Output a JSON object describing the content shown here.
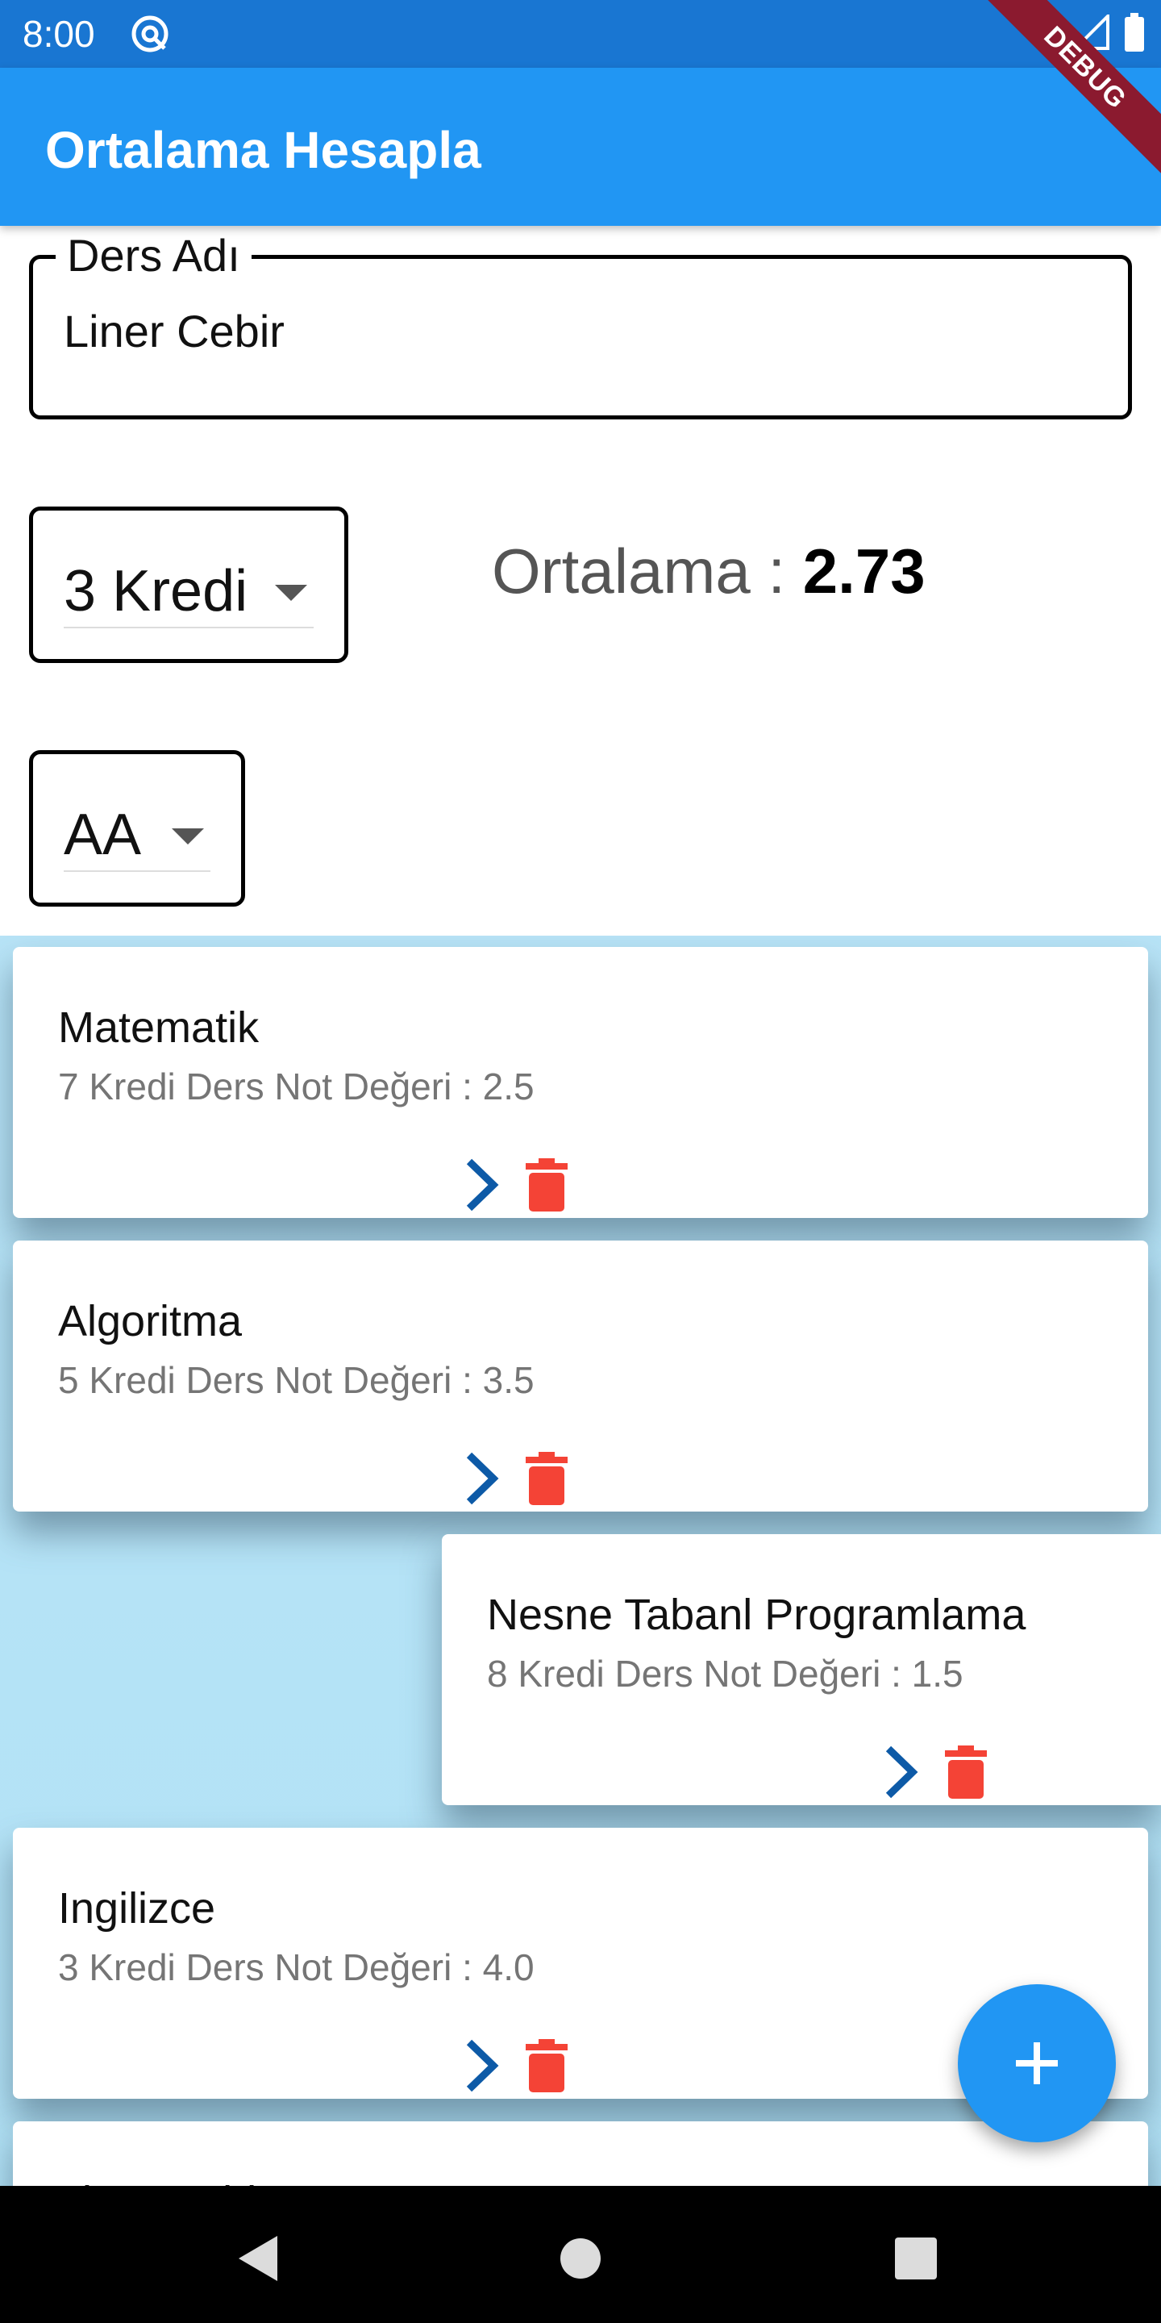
{
  "status_bar": {
    "time": "8:00"
  },
  "app_bar": {
    "title": "Ortalama Hesapla"
  },
  "debug_banner": "DEBUG",
  "form": {
    "course_label": "Ders Adı",
    "course_value": "Liner Cebir",
    "credit_selected": "3 Kredi",
    "grade_selected": "AA",
    "average_label": "Ortalama : ",
    "average_value": "2.73"
  },
  "courses": [
    {
      "name": "Matematik",
      "detail": "7 Kredi Ders Not Değeri : 2.5"
    },
    {
      "name": "Algoritma",
      "detail": "5 Kredi Ders Not Değeri : 3.5"
    },
    {
      "name": "Nesne Tabanl Programlama",
      "detail": "8 Kredi Ders Not Değeri : 1.5"
    },
    {
      "name": "Ingilizce",
      "detail": "3 Kredi Ders Not Değeri : 4.0"
    },
    {
      "name": "Liner Cebir",
      "detail": ""
    }
  ],
  "colors": {
    "status_bar": "#1976D2",
    "app_bar": "#2196F3",
    "list_background": "#b8e4f7",
    "chevron": "#0D5AA7",
    "delete": "#F44336",
    "fab": "#2196F3",
    "debug_banner": "#8B1A2F"
  },
  "icons": {
    "status_app": "at-icon",
    "wifi": "wifi-icon",
    "signal": "signal-icon",
    "battery": "battery-icon",
    "card_chevron": "chevron-right-icon",
    "card_delete": "trash-icon",
    "fab": "add-icon",
    "nav_back": "back-triangle-icon",
    "nav_home": "home-circle-icon",
    "nav_recents": "recents-square-icon"
  }
}
